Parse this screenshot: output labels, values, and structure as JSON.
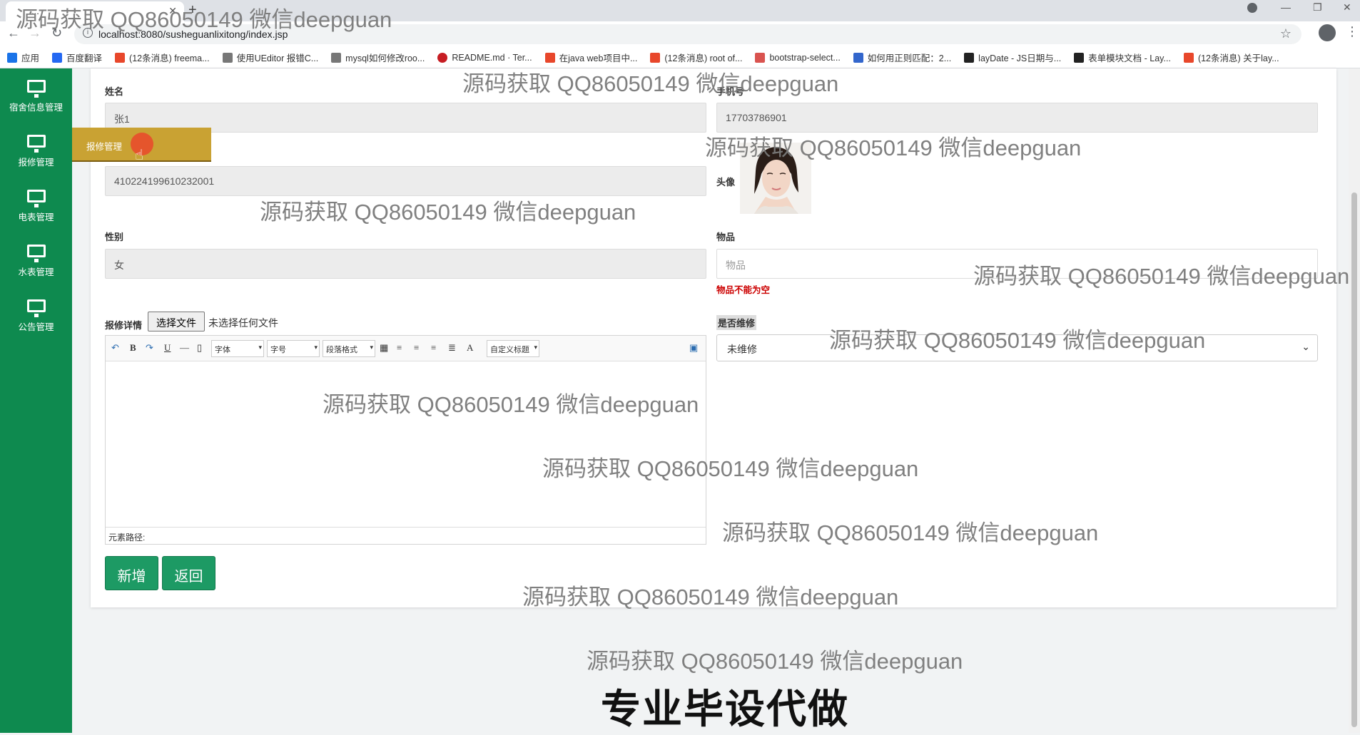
{
  "browser": {
    "tab_title": "...",
    "url": "localhost:8080/susheguanlixitong/index.jsp",
    "bookmarks": [
      {
        "label": "应用",
        "color": "#1a73e8"
      },
      {
        "label": "百度翻译",
        "color": "#2468f2"
      },
      {
        "label": "(12条消息) freema...",
        "color": "#e8472b"
      },
      {
        "label": "使用UEditor 报错C...",
        "color": "#555555"
      },
      {
        "label": "mysql如何修改roo...",
        "color": "#555555"
      },
      {
        "label": "README.md · Ter...",
        "color": "#c71d23"
      },
      {
        "label": "在java web项目中...",
        "color": "#e8472b"
      },
      {
        "label": "(12条消息) root of...",
        "color": "#e8472b"
      },
      {
        "label": "bootstrap-select...",
        "color": "#d9534f"
      },
      {
        "label": "如何用正则匹配：2...",
        "color": "#3366cc"
      },
      {
        "label": "layDate - JS日期与...",
        "color": "#222222"
      },
      {
        "label": "表单模块文档 - Lay...",
        "color": "#222222"
      },
      {
        "label": "(12条消息) 关于lay...",
        "color": "#e8472b"
      }
    ]
  },
  "sidebar": {
    "items": [
      {
        "label": "宿舍信息管理",
        "icon": "monitor-icon"
      },
      {
        "label": "报修管理",
        "icon": "monitor-icon"
      },
      {
        "label": "电表管理",
        "icon": "monitor-icon"
      },
      {
        "label": "水表管理",
        "icon": "monitor-icon"
      },
      {
        "label": "公告管理",
        "icon": "monitor-icon"
      }
    ],
    "flyout_label": "报修管理"
  },
  "form": {
    "name_label": "姓名",
    "name_value": "张1",
    "phone_label": "手机号",
    "phone_value": "17703786901",
    "idcard_value": "410224199610232001",
    "avatar_label": "头像",
    "gender_label": "性别",
    "gender_value": "女",
    "item_label": "物品",
    "item_placeholder": "物品",
    "item_error": "物品不能为空",
    "detail_label": "报修详情",
    "file_button": "选择文件",
    "file_none": "未选择任何文件",
    "repaired_label": "是否维修",
    "repaired_value": "未维修",
    "editor_toolbar": {
      "font": "字体",
      "size": "字号",
      "paragraph": "段落格式",
      "custom_title": "自定义标题",
      "bold": "B",
      "underline": "U",
      "font_color": "A"
    },
    "editor_status": "元素路径:",
    "add_button": "新增",
    "back_button": "返回"
  },
  "watermarks": {
    "text": "源码获取 QQ86050149 微信deepguan",
    "big": "专业毕设代做"
  }
}
